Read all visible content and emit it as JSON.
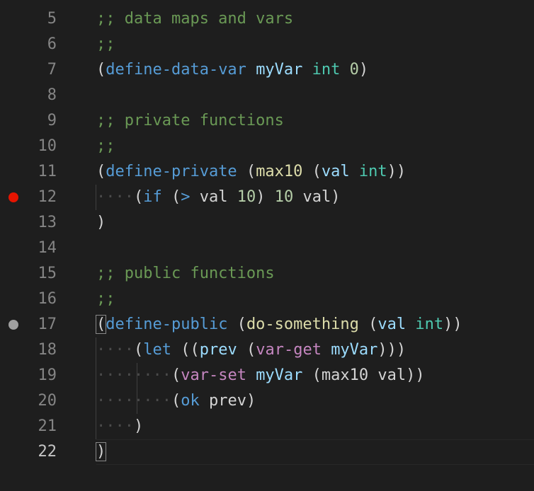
{
  "editor": {
    "lines": [
      {
        "num": "5",
        "tokens": [
          {
            "t": ";; data maps and vars",
            "c": "c-comment"
          }
        ]
      },
      {
        "num": "6",
        "tokens": [
          {
            "t": ";;",
            "c": "c-comment"
          }
        ]
      },
      {
        "num": "7",
        "tokens": [
          {
            "t": "(",
            "c": "c-plain"
          },
          {
            "t": "define-data-var",
            "c": "c-kw"
          },
          {
            "t": " ",
            "c": "ws"
          },
          {
            "t": "myVar",
            "c": "c-var"
          },
          {
            "t": " ",
            "c": "ws"
          },
          {
            "t": "int",
            "c": "c-type"
          },
          {
            "t": " ",
            "c": "ws"
          },
          {
            "t": "0",
            "c": "c-num"
          },
          {
            "t": ")",
            "c": "c-plain"
          }
        ]
      },
      {
        "num": "8",
        "tokens": []
      },
      {
        "num": "9",
        "tokens": [
          {
            "t": ";; private functions",
            "c": "c-comment"
          }
        ]
      },
      {
        "num": "10",
        "tokens": [
          {
            "t": ";;",
            "c": "c-comment"
          }
        ]
      },
      {
        "num": "11",
        "tokens": [
          {
            "t": "(",
            "c": "c-plain"
          },
          {
            "t": "define-private",
            "c": "c-kw"
          },
          {
            "t": " (",
            "c": "c-plain"
          },
          {
            "t": "max10",
            "c": "c-fn"
          },
          {
            "t": " (",
            "c": "c-plain"
          },
          {
            "t": "val",
            "c": "c-var"
          },
          {
            "t": " ",
            "c": "ws"
          },
          {
            "t": "int",
            "c": "c-type"
          },
          {
            "t": "))",
            "c": "c-plain"
          }
        ]
      },
      {
        "num": "12",
        "breakpoint": "red",
        "tokens": [
          {
            "t": "····",
            "c": "ws"
          },
          {
            "t": "(",
            "c": "c-plain"
          },
          {
            "t": "if",
            "c": "c-kw"
          },
          {
            "t": " (",
            "c": "c-plain"
          },
          {
            "t": ">",
            "c": "c-kw"
          },
          {
            "t": " val ",
            "c": "c-plain"
          },
          {
            "t": "10",
            "c": "c-num"
          },
          {
            "t": ") ",
            "c": "c-plain"
          },
          {
            "t": "10",
            "c": "c-num"
          },
          {
            "t": " val)",
            "c": "c-plain"
          }
        ]
      },
      {
        "num": "13",
        "tokens": [
          {
            "t": ")",
            "c": "c-plain"
          }
        ]
      },
      {
        "num": "14",
        "tokens": []
      },
      {
        "num": "15",
        "tokens": [
          {
            "t": ";; public functions",
            "c": "c-comment"
          }
        ]
      },
      {
        "num": "16",
        "tokens": [
          {
            "t": ";;",
            "c": "c-comment"
          }
        ]
      },
      {
        "num": "17",
        "breakpoint": "grey",
        "tokens": [
          {
            "t": "(",
            "c": "c-plain bracket-box"
          },
          {
            "t": "define-public",
            "c": "c-kw"
          },
          {
            "t": " (",
            "c": "c-plain"
          },
          {
            "t": "do-something",
            "c": "c-fn"
          },
          {
            "t": " (",
            "c": "c-plain"
          },
          {
            "t": "val",
            "c": "c-var"
          },
          {
            "t": " ",
            "c": "ws"
          },
          {
            "t": "int",
            "c": "c-type"
          },
          {
            "t": "))",
            "c": "c-plain"
          }
        ]
      },
      {
        "num": "18",
        "tokens": [
          {
            "t": "····",
            "c": "ws"
          },
          {
            "t": "(",
            "c": "c-plain"
          },
          {
            "t": "let",
            "c": "c-kw"
          },
          {
            "t": " ((",
            "c": "c-plain"
          },
          {
            "t": "prev",
            "c": "c-var"
          },
          {
            "t": " (",
            "c": "c-plain"
          },
          {
            "t": "var-get",
            "c": "c-pink"
          },
          {
            "t": " ",
            "c": "ws"
          },
          {
            "t": "myVar",
            "c": "c-var"
          },
          {
            "t": ")))",
            "c": "c-plain"
          }
        ]
      },
      {
        "num": "19",
        "tokens": [
          {
            "t": "········",
            "c": "ws"
          },
          {
            "t": "(",
            "c": "c-plain"
          },
          {
            "t": "var-set",
            "c": "c-pink"
          },
          {
            "t": " ",
            "c": "ws"
          },
          {
            "t": "myVar",
            "c": "c-var"
          },
          {
            "t": " (max10 val))",
            "c": "c-plain"
          }
        ]
      },
      {
        "num": "20",
        "tokens": [
          {
            "t": "········",
            "c": "ws"
          },
          {
            "t": "(",
            "c": "c-plain"
          },
          {
            "t": "ok",
            "c": "c-kw"
          },
          {
            "t": " prev)",
            "c": "c-plain"
          }
        ]
      },
      {
        "num": "21",
        "tokens": [
          {
            "t": "····",
            "c": "ws"
          },
          {
            "t": ")",
            "c": "c-plain"
          }
        ]
      },
      {
        "num": "22",
        "active": true,
        "tokens": [
          {
            "t": ")",
            "c": "c-plain bracket-box"
          }
        ]
      }
    ]
  }
}
